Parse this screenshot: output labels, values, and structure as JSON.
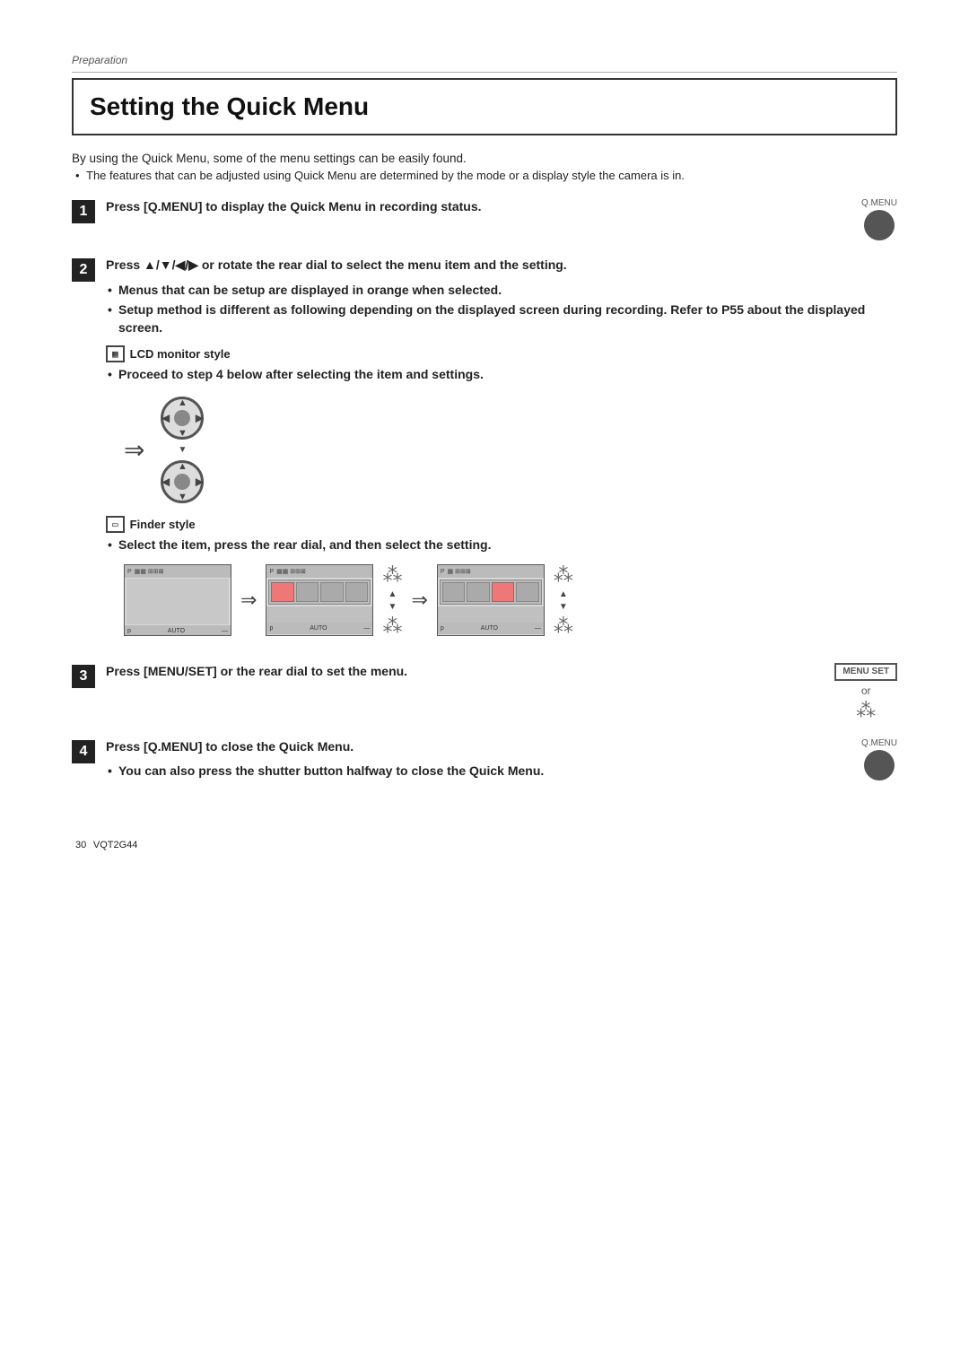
{
  "page": {
    "section": "Preparation",
    "title": "Setting the Quick Menu",
    "intro": "By using the Quick Menu, some of the menu settings can be easily found.",
    "bullet1": "The features that can be adjusted using Quick Menu are determined by the mode or a display style the camera is in.",
    "steps": [
      {
        "num": "1",
        "heading": "Press [Q.MENU] to display the Quick Menu in recording status.",
        "icon_label": "Q.MENU",
        "has_icon": true
      },
      {
        "num": "2",
        "heading": "Press ▲/▼/◀/▶ or rotate the rear dial to select the menu item and the setting.",
        "has_icon": false,
        "sub_bullets": [
          "Menus that can be setup are displayed in orange when selected.",
          "Setup method is different as following depending on the displayed screen during recording. Refer to P55 about the displayed screen."
        ],
        "lcd_label": "LCD monitor style",
        "lcd_sub": "Proceed to step 4 below after selecting the item and settings.",
        "finder_label": "Finder style",
        "finder_sub": "Select the item, press the rear dial, and then select the setting."
      },
      {
        "num": "3",
        "heading": "Press [MENU/SET] or the rear dial to set the menu.",
        "has_icon": true,
        "icon_label_top": "MENU SET",
        "or_text": "or"
      },
      {
        "num": "4",
        "heading": "Press [Q.MENU] to close the Quick Menu.",
        "has_icon": true,
        "icon_label": "Q.MENU",
        "sub_bullet": "You can also press the shutter button halfway to close the Quick Menu."
      }
    ],
    "footer_page": "30",
    "footer_code": "VQT2G44"
  }
}
